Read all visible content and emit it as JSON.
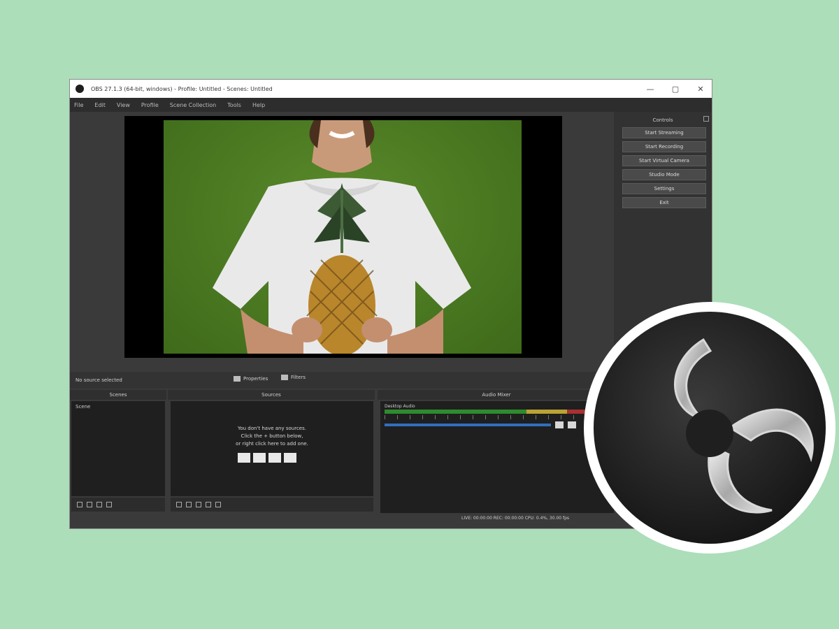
{
  "window": {
    "title": "OBS 27.1.3 (64-bit, windows) - Profile: Untitled - Scenes: Untitled",
    "controls": {
      "minimize": "—",
      "maximize": "▢",
      "close": "✕"
    }
  },
  "menu": [
    "File",
    "Edit",
    "View",
    "Profile",
    "Scene Collection",
    "Tools",
    "Help"
  ],
  "controls_dock": {
    "title": "Controls",
    "buttons": [
      "Start Streaming",
      "Start Recording",
      "Start Virtual Camera",
      "Studio Mode",
      "Settings",
      "Exit"
    ]
  },
  "status_strip": {
    "scene_label": "No source selected",
    "properties_label": "Properties",
    "filters_label": "Filters"
  },
  "scenes_dock": {
    "title": "Scenes",
    "items": [
      "Scene"
    ]
  },
  "sources_dock": {
    "title": "Sources",
    "hint_lines": [
      "You don't have any sources.",
      "Click the + button below,",
      "or right click here to add one."
    ]
  },
  "mixer_dock": {
    "title": "Audio Mixer",
    "channel": "Desktop Audio"
  },
  "bottom_status": "LIVE: 00:00:00   REC: 00:00:00   CPU: 0.4%, 30.00 fps",
  "colors": {
    "page_bg": "#abdeb9",
    "app_bg": "#3a3a3a",
    "preview_green": "#4c7a22",
    "meter_green": "#2e8b2e",
    "meter_yellow": "#b9a336",
    "meter_red": "#a83030",
    "volume_blue": "#2f6fbf"
  },
  "icons": [
    "obs-logo",
    "window-close",
    "window-maximize",
    "window-minimize",
    "add",
    "remove",
    "settings",
    "move-up",
    "move-down"
  ]
}
